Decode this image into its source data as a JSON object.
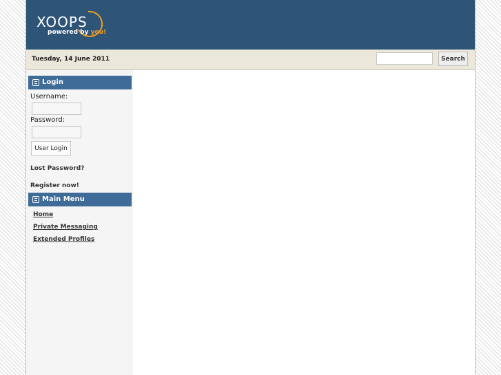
{
  "header": {
    "logo_word": "XOOPS",
    "logo_tagline_prefix": "powered by",
    "logo_tagline_you": "you!"
  },
  "topbar": {
    "date": "Tuesday, 14 June 2011",
    "search_value": "",
    "search_button": "Search"
  },
  "login_block": {
    "title": "Login",
    "username_label": "Username:",
    "username_value": "",
    "password_label": "Password:",
    "password_value": "",
    "submit_label": "User Login",
    "lost_password": "Lost Password?",
    "register": "Register now!"
  },
  "main_menu": {
    "title": "Main Menu",
    "items": [
      {
        "label": "Home"
      },
      {
        "label": "Private Messaging"
      },
      {
        "label": "Extended Profiles"
      }
    ]
  },
  "colors": {
    "header_bg": "#2e5478",
    "block_title_bg": "#3e6b97",
    "topbar_bg": "#ebe7da",
    "sidebar_bg": "#f4f5f4",
    "logo_accent": "#f0a020"
  }
}
